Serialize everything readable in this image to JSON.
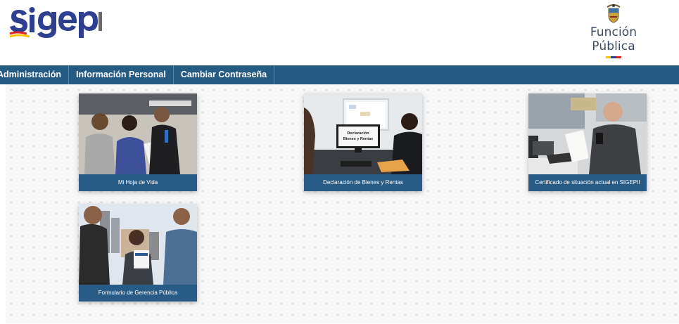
{
  "header": {
    "logo_alt": "sigepII",
    "brand_right": "Función Pública"
  },
  "navbar": {
    "items": [
      {
        "label": "Administración"
      },
      {
        "label": "Información Personal"
      },
      {
        "label": "Cambiar Contraseña"
      }
    ]
  },
  "cards": [
    {
      "label": "Mi Hoja de Vida"
    },
    {
      "label": "Declaración de Bienes y Rentas",
      "screen_text": "Declaración Bienes y Rentas"
    },
    {
      "label": "Certificado de situación actual en SIGEPII"
    },
    {
      "label": "Formulario de Gerencia Pública"
    }
  ],
  "colors": {
    "navbar": "#255a83",
    "card_caption": "#285b85",
    "logo_blue": "#2e3f8f",
    "logo_red": "#d9262c",
    "logo_yellow": "#f5c400"
  }
}
